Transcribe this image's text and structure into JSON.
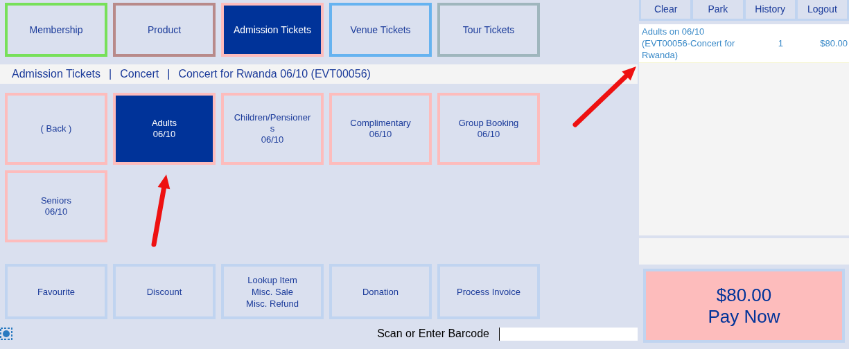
{
  "categories": [
    {
      "label": "Membership",
      "color": "#77e05a",
      "selected": false
    },
    {
      "label": "Product",
      "color": "#b88a8a",
      "selected": false
    },
    {
      "label": "Admission Tickets",
      "color": "#fdbcbc",
      "selected": true
    },
    {
      "label": "Venue Tickets",
      "color": "#66b3f0",
      "selected": false
    },
    {
      "label": "Tour Tickets",
      "color": "#9fb6bd",
      "selected": false
    }
  ],
  "breadcrumb": {
    "separator": "|",
    "items": [
      "Admission Tickets",
      "Concert",
      "Concert for Rwanda 06/10 (EVT00056)"
    ]
  },
  "tickets": [
    {
      "kind": "back",
      "label": "( Back )",
      "selected": false
    },
    {
      "kind": "ticket",
      "label": "Adults",
      "date": "06/10",
      "selected": true
    },
    {
      "kind": "ticket",
      "label": "Children/Pensioners",
      "date": "06/10",
      "selected": false
    },
    {
      "kind": "ticket",
      "label": "Complimentary",
      "date": "06/10",
      "selected": false
    },
    {
      "kind": "ticket",
      "label": "Group Booking",
      "date": "06/10",
      "selected": false
    },
    {
      "kind": "ticket",
      "label": "Seniors",
      "date": "06/10",
      "selected": false
    }
  ],
  "actions": [
    {
      "lines": [
        "Favourite"
      ]
    },
    {
      "lines": [
        "Discount"
      ]
    },
    {
      "lines": [
        "Lookup Item",
        "Misc. Sale",
        "Misc. Refund"
      ]
    },
    {
      "lines": [
        "Donation"
      ]
    },
    {
      "lines": [
        "Process Invoice"
      ]
    }
  ],
  "barcode": {
    "label": "Scan or Enter Barcode"
  },
  "toolbar": [
    "Clear",
    "Park",
    "History",
    "Logout"
  ],
  "cart": [
    {
      "description": "Adults on 06/10 (EVT00056-Concert for Rwanda)",
      "qty": "1",
      "price": "$80.00"
    }
  ],
  "pay": {
    "amount": "$80.00",
    "label": "Pay Now"
  }
}
